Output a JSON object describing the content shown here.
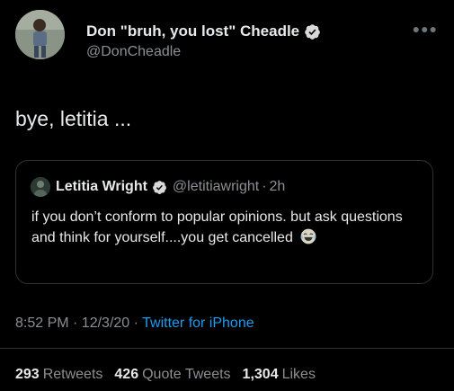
{
  "tweet": {
    "author_name": "Don \"bruh, you lost\" Cheadle",
    "author_handle": "@DonCheadle",
    "text": "bye, letitia ...",
    "more_icon": "more-horizontal-icon",
    "timestamp": "8:52 PM · 12/3/20",
    "separator": "·",
    "source": "Twitter for iPhone"
  },
  "quoted_tweet": {
    "author_name": "Letitia Wright",
    "author_handle": "@letitiawright",
    "separator": "·",
    "time": "2h",
    "text": "if you don’t conform to popular opinions. but ask questions and think for yourself....you get cancelled",
    "emoji": "face-with-tears-of-joy-icon"
  },
  "stats": {
    "retweets_count": "293",
    "retweets_label": "Retweets",
    "quotes_count": "426",
    "quotes_label": "Quote Tweets",
    "likes_count": "1,304",
    "likes_label": "Likes"
  },
  "colors": {
    "background": "#000000",
    "text": "#e7e9ea",
    "secondary": "#8b8f94",
    "link": "#1d9bf0",
    "verified": "#d9d9d9"
  }
}
